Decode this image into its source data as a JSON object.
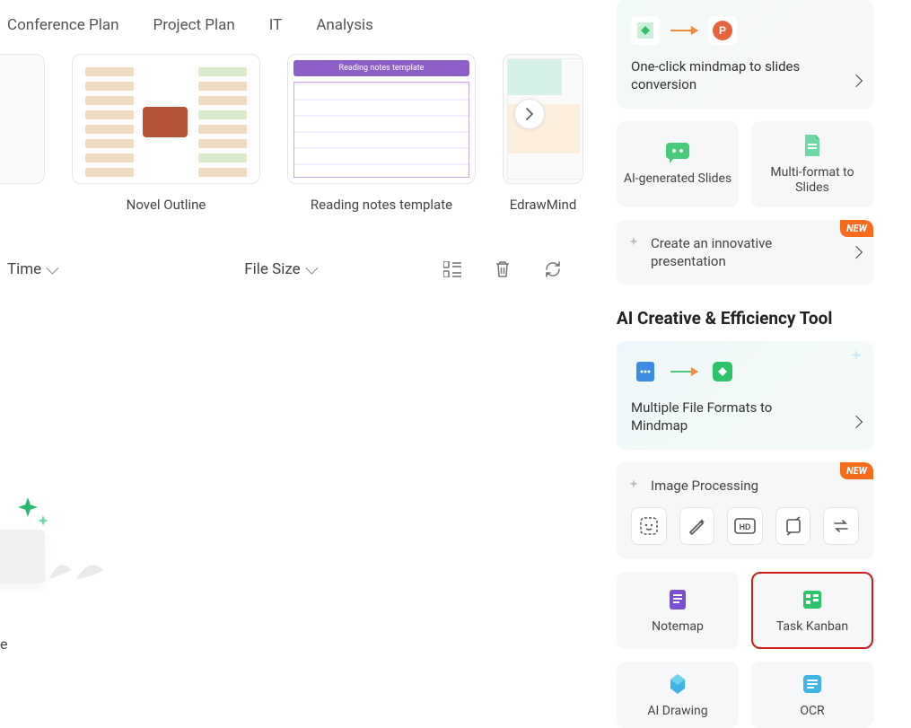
{
  "tabs": [
    "Conference Plan",
    "Project Plan",
    "IT",
    "Analysis"
  ],
  "templates": [
    {
      "label": ""
    },
    {
      "label": "Novel Outline"
    },
    {
      "label": "Reading notes template"
    },
    {
      "label": "EdrawMind"
    }
  ],
  "reading_thumb_title": "Reading notes template",
  "toolbar": {
    "time": "Time",
    "filesize": "File Size"
  },
  "truncated": "e",
  "right": {
    "oneclick": "One-click mindmap to slides conversion",
    "ai_slides": "AI-generated Slides",
    "multi_format": "Multi-format to Slides",
    "create_presentation": "Create an innovative presentation",
    "new_badge": "NEW",
    "section_title": "AI Creative & Efficiency Tool",
    "multi_file": "Multiple File Formats to Mindmap",
    "image_processing": "Image Processing",
    "notemap": "Notemap",
    "task_kanban": "Task Kanban",
    "ai_drawing": "AI Drawing",
    "ocr": "OCR"
  }
}
